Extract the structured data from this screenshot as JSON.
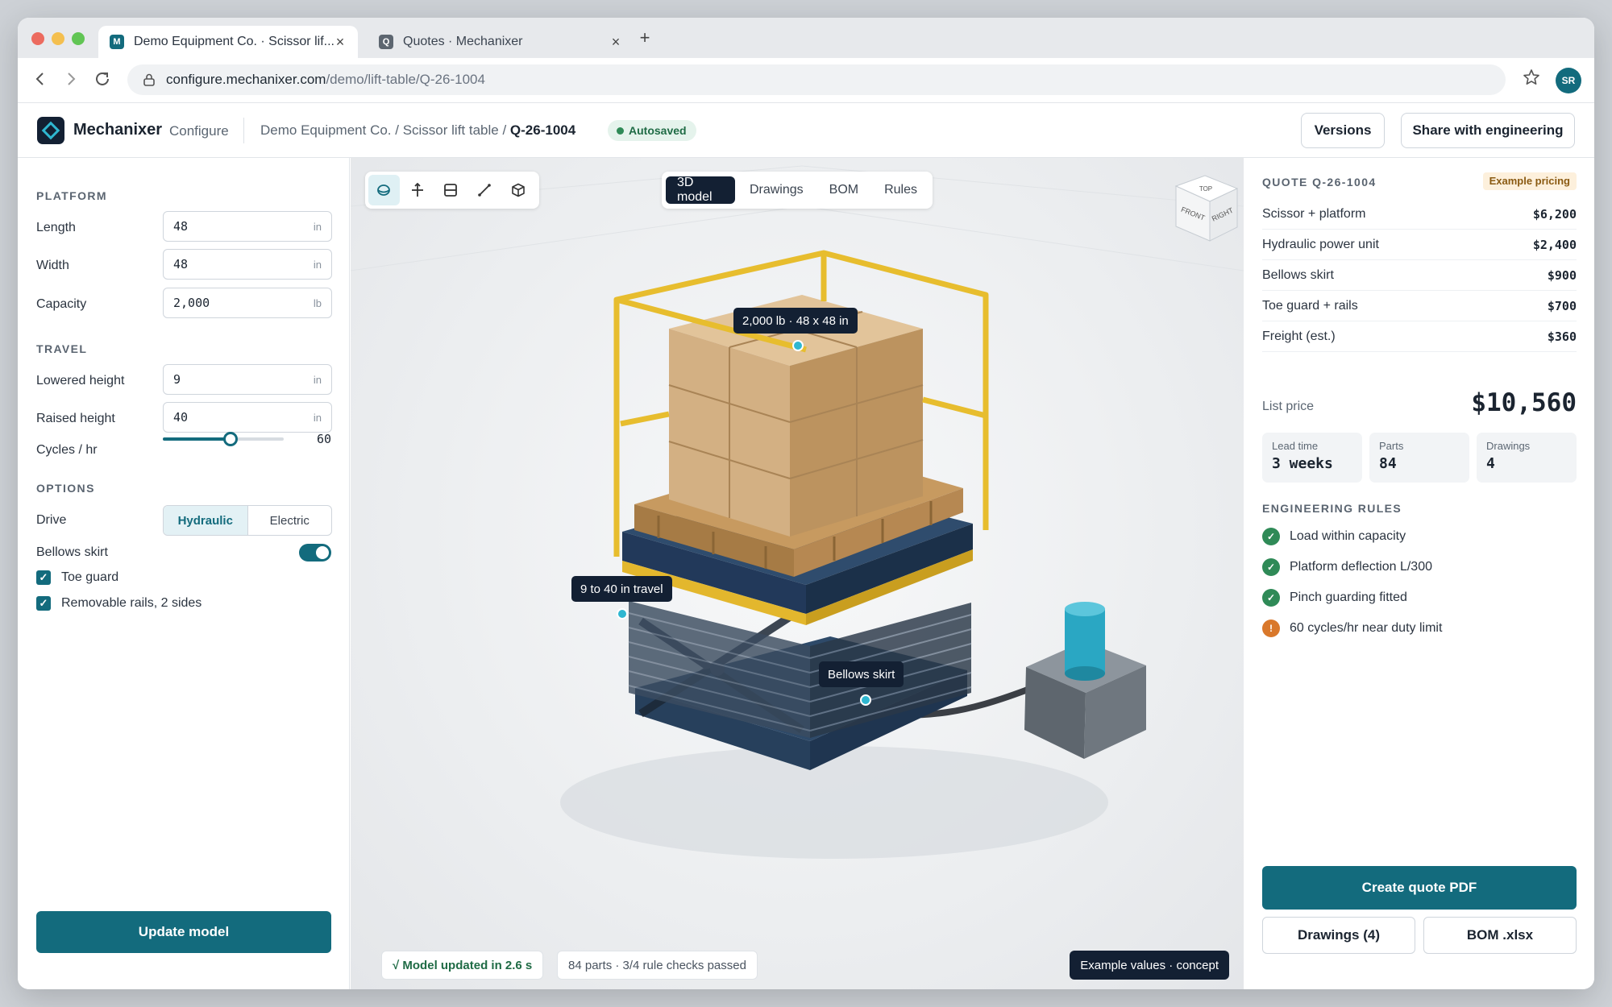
{
  "browser": {
    "tabs": [
      {
        "title": "Demo Equipment Co. · Scissor lif...",
        "favicon": "M",
        "close": "×"
      },
      {
        "title": "Quotes · Mechanixer",
        "favicon": "Q",
        "close": "×"
      }
    ],
    "new_tab": "+",
    "url_host": "configure.mechanixer.com",
    "url_path": "/demo/lift-table/Q-26-1004",
    "profile_initials": "SR"
  },
  "header": {
    "brand": "Mechanixer",
    "configure": "Configure",
    "breadcrumb_prefix": "Demo Equipment Co. / Scissor lift table / ",
    "breadcrumb_current": "Q-26-1004",
    "autosaved": "Autosaved",
    "versions": "Versions",
    "share": "Share with engineering"
  },
  "platform": {
    "title": "PLATFORM",
    "length": {
      "label": "Length",
      "value": "48",
      "unit": "in"
    },
    "width": {
      "label": "Width",
      "value": "48",
      "unit": "in"
    },
    "capacity": {
      "label": "Capacity",
      "value": "2,000",
      "unit": "lb"
    }
  },
  "travel": {
    "title": "TRAVEL",
    "lowered": {
      "label": "Lowered height",
      "value": "9",
      "unit": "in"
    },
    "raised": {
      "label": "Raised height",
      "value": "40",
      "unit": "in"
    },
    "cycles": {
      "label": "Cycles / hr",
      "value": "60",
      "fill_fraction": 0.56
    }
  },
  "options": {
    "title": "OPTIONS",
    "drive_label": "Drive",
    "drive_options": [
      "Hydraulic",
      "Electric"
    ],
    "drive_selected": "Hydraulic",
    "bellows_label": "Bellows skirt",
    "bellows_on": true,
    "toe_guard": "Toe guard",
    "rails": "Removable rails, 2 sides",
    "check_mark": "✓"
  },
  "update_button": "Update model",
  "viewport": {
    "tools": [
      "orbit-icon",
      "move-icon",
      "section-icon",
      "measure-icon",
      "cube-icon"
    ],
    "view_tabs": [
      "3D model",
      "Drawings",
      "BOM",
      "Rules"
    ],
    "view_selected": "3D model",
    "cube_faces": {
      "top": "TOP",
      "front": "FRONT",
      "right": "RIGHT"
    },
    "callouts": {
      "load": "2,000 lb · 48 x 48 in",
      "travel": "9 to 40 in travel",
      "bellows": "Bellows skirt"
    },
    "status_ok": "√ Model updated in 2.6 s",
    "status_info": "84 parts · 3/4 rule checks passed",
    "concept": "Example values · concept"
  },
  "quote": {
    "title": "QUOTE Q-26-1004",
    "badge": "Example pricing",
    "lines": [
      {
        "label": "Scissor + platform",
        "amount": "$6,200"
      },
      {
        "label": "Hydraulic power unit",
        "amount": "$2,400"
      },
      {
        "label": "Bellows skirt",
        "amount": "$900"
      },
      {
        "label": "Toe guard + rails",
        "amount": "$700"
      },
      {
        "label": "Freight (est.)",
        "amount": "$360"
      }
    ],
    "list_price_label": "List price",
    "list_price": "$10,560",
    "stats": [
      {
        "label": "Lead time",
        "value": "3 weeks"
      },
      {
        "label": "Parts",
        "value": "84"
      },
      {
        "label": "Drawings",
        "value": "4"
      }
    ]
  },
  "rules": {
    "title": "ENGINEERING RULES",
    "items": [
      {
        "label": "Load within capacity",
        "status": "ok",
        "icon": "✓"
      },
      {
        "label": "Platform deflection L/300",
        "status": "ok",
        "icon": "✓"
      },
      {
        "label": "Pinch guarding fitted",
        "status": "ok",
        "icon": "✓"
      },
      {
        "label": "60 cycles/hr near duty limit",
        "status": "warn",
        "icon": "!"
      }
    ]
  },
  "actions": {
    "pdf": "Create quote PDF",
    "drawings": "Drawings (4)",
    "bom": "BOM .xlsx"
  },
  "colors": {
    "accent": "#136b7d",
    "navy": "#132033",
    "ok": "#2f8a57",
    "warn": "#d9782b"
  }
}
